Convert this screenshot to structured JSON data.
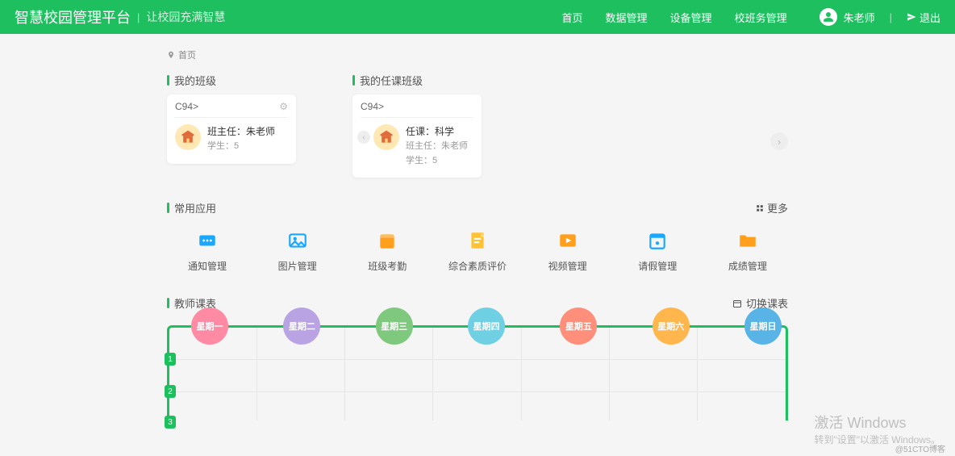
{
  "header": {
    "brand": "智慧校园管理平台",
    "tagline": "让校园充满智慧",
    "nav": [
      "首页",
      "数据管理",
      "设备管理",
      "校班务管理"
    ],
    "user": "朱老师",
    "logout": "退出"
  },
  "breadcrumb": "首页",
  "sections": {
    "my_class": {
      "title": "我的班级",
      "card": {
        "name": "C94>",
        "line1": "班主任：朱老师",
        "line2": "学生：5"
      }
    },
    "teach_class": {
      "title": "我的任课班级",
      "card": {
        "name": "C94>",
        "line1": "任课：科学",
        "line2": "班主任：朱老师",
        "line3": "学生：5"
      }
    }
  },
  "apps": {
    "title": "常用应用",
    "more": "更多",
    "items": [
      {
        "label": "通知管理",
        "color": "#19a8ff",
        "icon": "message"
      },
      {
        "label": "图片管理",
        "color": "#19a8ff",
        "icon": "image"
      },
      {
        "label": "班级考勤",
        "color": "#ff9f1c",
        "icon": "calendar"
      },
      {
        "label": "综合素质评价",
        "color": "#ffc233",
        "icon": "note"
      },
      {
        "label": "视频管理",
        "color": "#ff9f1c",
        "icon": "video"
      },
      {
        "label": "请假管理",
        "color": "#19a8ff",
        "icon": "calendar2"
      },
      {
        "label": "成绩管理",
        "color": "#ff9f1c",
        "icon": "folder"
      }
    ]
  },
  "schedule": {
    "title": "教师课表",
    "switch": "切换课表",
    "days": [
      {
        "label": "星期一",
        "color": "#ff8aa4"
      },
      {
        "label": "星期二",
        "color": "#b9a3e3"
      },
      {
        "label": "星期三",
        "color": "#7ec97e"
      },
      {
        "label": "星期四",
        "color": "#6fcfe3"
      },
      {
        "label": "星期五",
        "color": "#ff8f7a"
      },
      {
        "label": "星期六",
        "color": "#ffb74d"
      },
      {
        "label": "星期日",
        "color": "#58b4e6"
      }
    ],
    "rows": [
      "1",
      "2",
      "3"
    ]
  },
  "watermark": {
    "line1": "激活 Windows",
    "line2": "转到\"设置\"以激活 Windows。"
  },
  "corner": "@51CTO博客"
}
